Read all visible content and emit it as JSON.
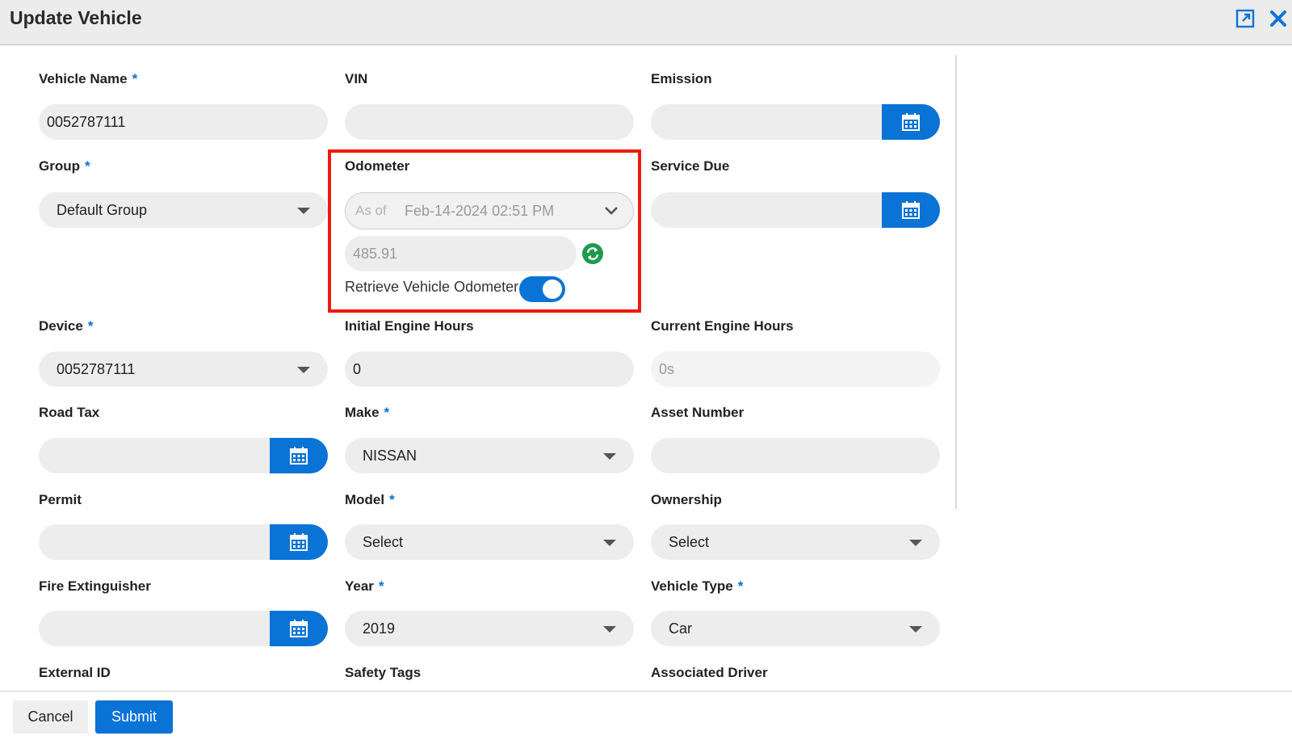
{
  "dialog": {
    "title": "Update Vehicle"
  },
  "required_marker": "*",
  "fields": {
    "vehicle_name": {
      "label": "Vehicle Name",
      "value": "0052787111"
    },
    "vin": {
      "label": "VIN",
      "value": ""
    },
    "emission": {
      "label": "Emission",
      "value": ""
    },
    "group": {
      "label": "Group",
      "value": "Default Group"
    },
    "odometer": {
      "label": "Odometer",
      "as_of_prefix": "As of",
      "as_of_value": "Feb-14-2024 02:51 PM",
      "reading": "485.91",
      "retrieve_label": "Retrieve Vehicle Odometer",
      "retrieve_enabled": true
    },
    "service_due": {
      "label": "Service Due",
      "value": ""
    },
    "device": {
      "label": "Device",
      "value": "0052787111"
    },
    "initial_engine_hours": {
      "label": "Initial Engine Hours",
      "value": "0"
    },
    "current_engine_hours": {
      "label": "Current Engine Hours",
      "value": "0s"
    },
    "road_tax": {
      "label": "Road Tax",
      "value": ""
    },
    "make": {
      "label": "Make",
      "value": "NISSAN"
    },
    "asset_number": {
      "label": "Asset Number",
      "value": ""
    },
    "permit": {
      "label": "Permit",
      "value": ""
    },
    "model": {
      "label": "Model",
      "value": "Select"
    },
    "ownership": {
      "label": "Ownership",
      "value": "Select"
    },
    "fire_extinguisher": {
      "label": "Fire Extinguisher",
      "value": ""
    },
    "year": {
      "label": "Year",
      "value": "2019"
    },
    "vehicle_type": {
      "label": "Vehicle Type",
      "value": "Car"
    },
    "external_id": {
      "label": "External ID"
    },
    "safety_tags": {
      "label": "Safety Tags"
    },
    "associated_driver": {
      "label": "Associated Driver"
    }
  },
  "footer": {
    "cancel_label": "Cancel",
    "submit_label": "Submit"
  },
  "colors": {
    "accent": "#0a73d6",
    "highlight": "#f0190f",
    "refresh": "#1e9a4f",
    "field_bg": "#ededed"
  },
  "icons": {
    "expand": "expand-icon",
    "close": "close-icon",
    "calendar": "calendar-icon",
    "refresh": "refresh-icon",
    "caret": "caret-down-icon"
  }
}
